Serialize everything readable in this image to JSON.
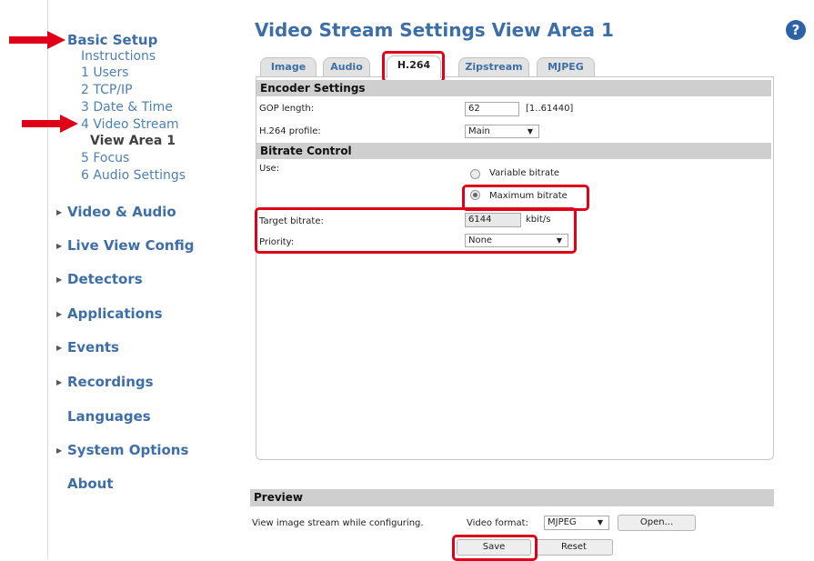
{
  "nav": {
    "basic_setup": "Basic Setup",
    "sub_items": [
      "Instructions",
      "1 Users",
      "2 TCP/IP",
      "3 Date & Time",
      "4 Video Stream",
      "View Area 1",
      "5 Focus",
      "6 Audio Settings"
    ],
    "sections": [
      "Video & Audio",
      "Live View Config",
      "Detectors",
      "Applications",
      "Events",
      "Recordings",
      "Languages",
      "System Options",
      "About"
    ]
  },
  "header": {
    "title": "Video Stream Settings View Area 1",
    "help_symbol": "?"
  },
  "tabs": [
    "Image",
    "Audio",
    "H.264",
    "Zipstream",
    "MJPEG"
  ],
  "active_tab": "H.264",
  "encoder": {
    "title": "Encoder Settings",
    "gop_label": "GOP length:",
    "gop_value": "62",
    "gop_range": "[1..61440]",
    "profile_label": "H.264 profile:",
    "profile_value": "Main"
  },
  "bitrate": {
    "title": "Bitrate Control",
    "use_label": "Use:",
    "option_variable": "Variable bitrate",
    "option_maximum": "Maximum bitrate",
    "selected": "Maximum bitrate",
    "target_label": "Target bitrate:",
    "target_value": "6144",
    "target_unit": "kbit/s",
    "priority_label": "Priority:",
    "priority_value": "None"
  },
  "preview": {
    "title": "Preview",
    "text": "View image stream while configuring.",
    "format_label": "Video format:",
    "format_value": "MJPEG",
    "open_button": "Open..."
  },
  "buttons": {
    "save": "Save",
    "reset": "Reset"
  },
  "colors": {
    "highlight": "#e0001a",
    "link": "#3d6fa6",
    "section_header": "#cfcfcf"
  },
  "icons": [
    "red-arrow-icon",
    "help-icon",
    "triangle-right-icon",
    "dropdown-arrow-icon"
  ]
}
